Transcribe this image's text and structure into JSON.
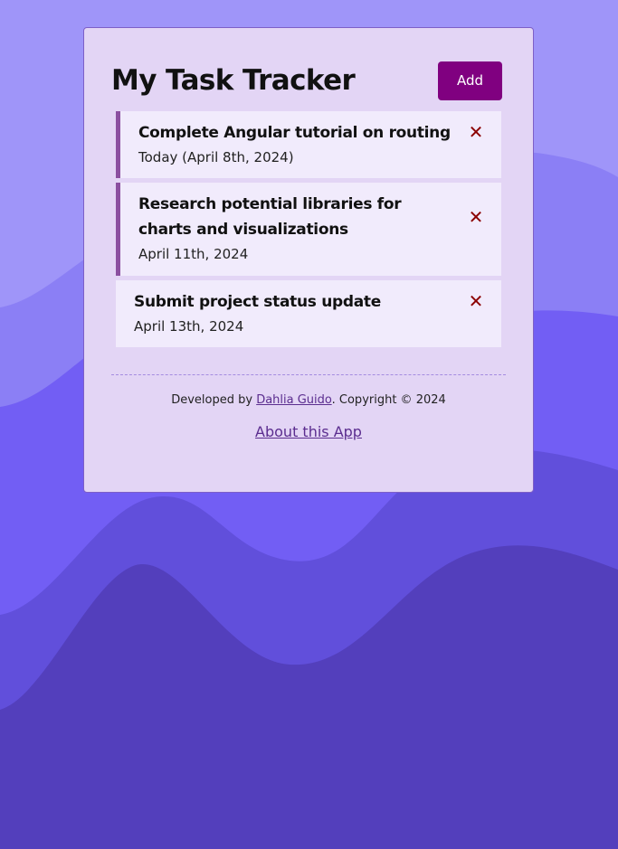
{
  "app": {
    "title": "My Task Tracker",
    "add_label": "Add"
  },
  "tasks": [
    {
      "title": "Complete Angular tutorial on routing",
      "date": "Today (April 8th, 2024)",
      "reminder": true
    },
    {
      "title": "Research potential libraries for charts and visualizations",
      "date": "April 11th, 2024",
      "reminder": true
    },
    {
      "title": "Submit project status update",
      "date": "April 13th, 2024",
      "reminder": false
    }
  ],
  "icons": {
    "delete": "close-icon"
  },
  "footer": {
    "prefix": "Developed by ",
    "author": "Dahlia Guido",
    "suffix": ". Copyright © 2024",
    "about_label": "About this App"
  },
  "colors": {
    "accent": "#800080",
    "card_bg": "#e3d5f5",
    "task_bg": "#f1ebfc",
    "reminder_border": "#8b4fa0",
    "delete": "#8b0000"
  }
}
